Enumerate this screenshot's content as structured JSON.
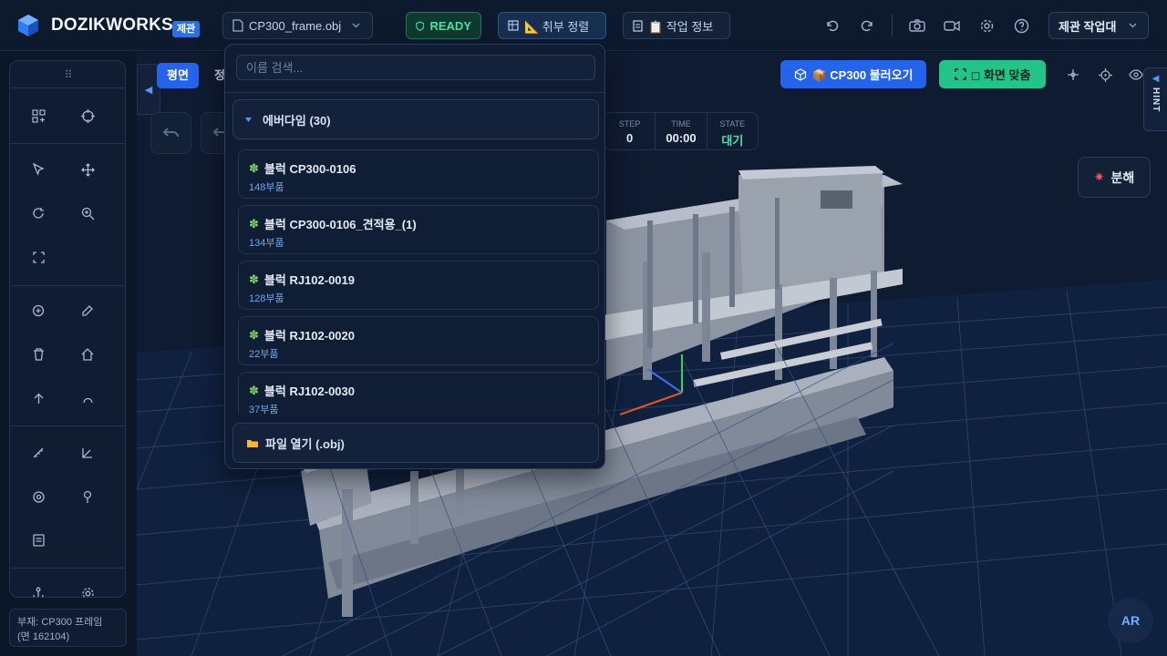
{
  "brand": {
    "name": "DOZIKWORKS",
    "badge": "제관"
  },
  "topbar": {
    "file_name": "CP300_frame.obj",
    "status": "READY",
    "sort_label": "📐 취부 정렬",
    "info_label": "📋 작업 정보",
    "workspace": "제관 작업대"
  },
  "view_tabs": [
    "평면",
    "정"
  ],
  "stats": {
    "step_label": "STEP",
    "step_value": "0",
    "time_label": "TIME",
    "time_value": "00:00",
    "state_label": "STATE",
    "state_value": "대기"
  },
  "actions": {
    "load_label": "📦 CP300 불러오기",
    "fit_label": "◻ 화면 맞춤",
    "hint_label": "HINT",
    "explode_label": "분해",
    "ar_label": "AR"
  },
  "status_box": {
    "line1": "부재: CP300 프레임",
    "line2": "(면 162104)"
  },
  "dropdown": {
    "search_placeholder": "이름 검색...",
    "group_label": "에버다임 (30)",
    "items": [
      {
        "title": "블럭 CP300-0106",
        "sub": "148부품"
      },
      {
        "title": "블럭 CP300-0106_견적용_(1)",
        "sub": "134부품"
      },
      {
        "title": "블럭 RJ102-0019",
        "sub": "128부품"
      },
      {
        "title": "블럭 RJ102-0020",
        "sub": "22부품"
      },
      {
        "title": "블럭 RJ102-0030",
        "sub": "37부품"
      }
    ],
    "open_label": "파일 열기 (.obj)"
  },
  "colors": {
    "accent": "#2563eb",
    "success": "#23c48a",
    "state": "#4fe0a8",
    "background": "#0b1629"
  }
}
